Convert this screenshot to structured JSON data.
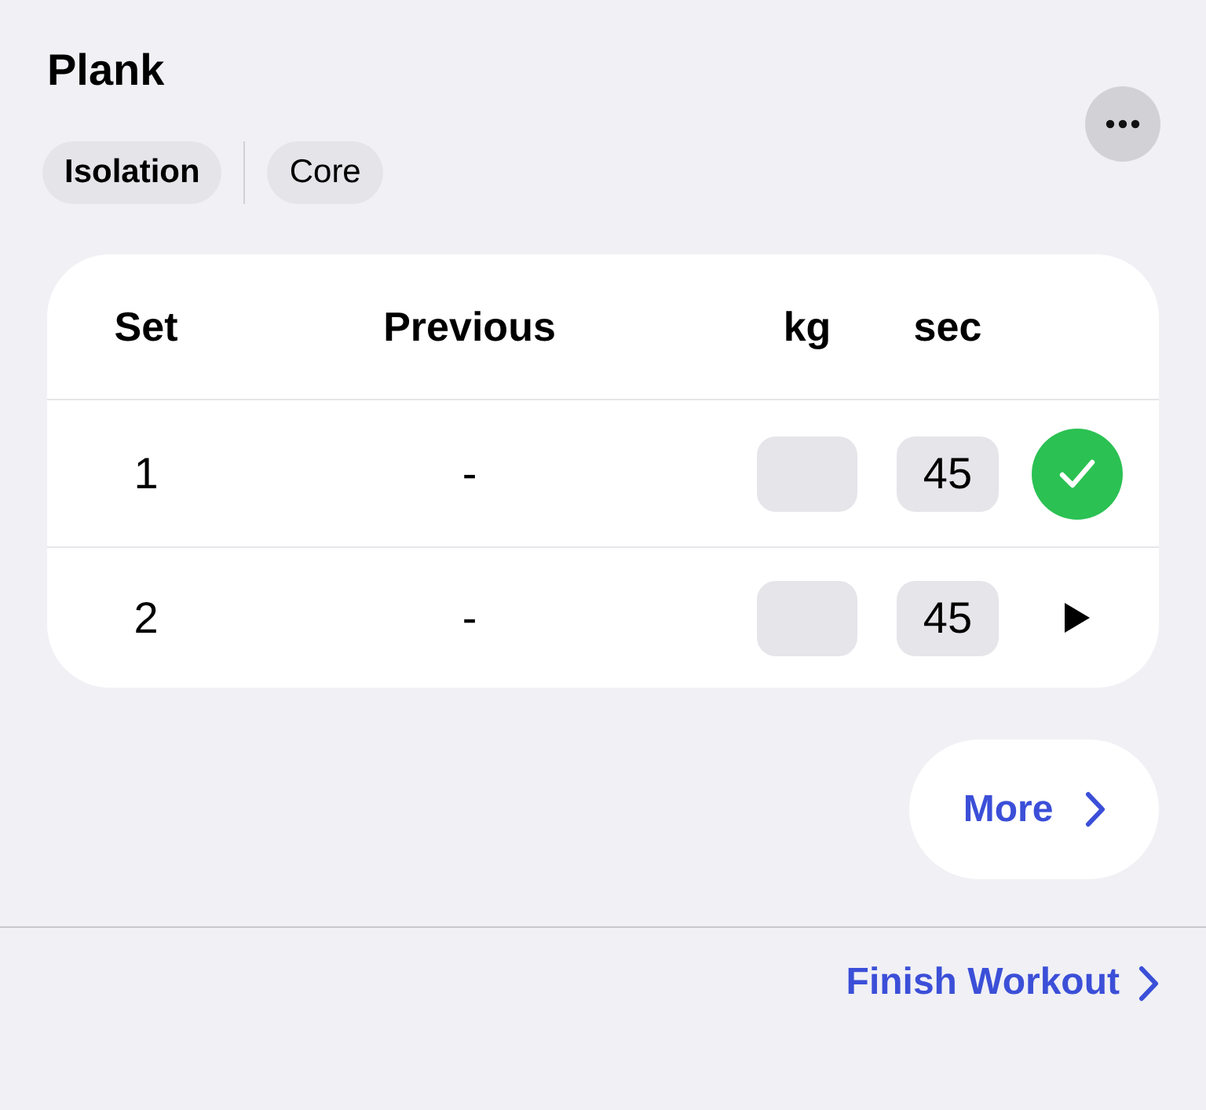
{
  "exercise": {
    "title": "Plank",
    "tags": [
      {
        "label": "Isolation",
        "kind": "primary"
      },
      {
        "label": "Core",
        "kind": "secondary"
      }
    ]
  },
  "table": {
    "columns": [
      "Set",
      "Previous",
      "kg",
      "sec"
    ],
    "rows": [
      {
        "set": "1",
        "previous": "-",
        "sec": "45",
        "completed": true
      },
      {
        "set": "2",
        "previous": "-",
        "sec": "45",
        "completed": false
      }
    ]
  },
  "more_button": {
    "label": "More"
  },
  "footer": {
    "finish_button": {
      "label": "Finish Workout"
    }
  }
}
